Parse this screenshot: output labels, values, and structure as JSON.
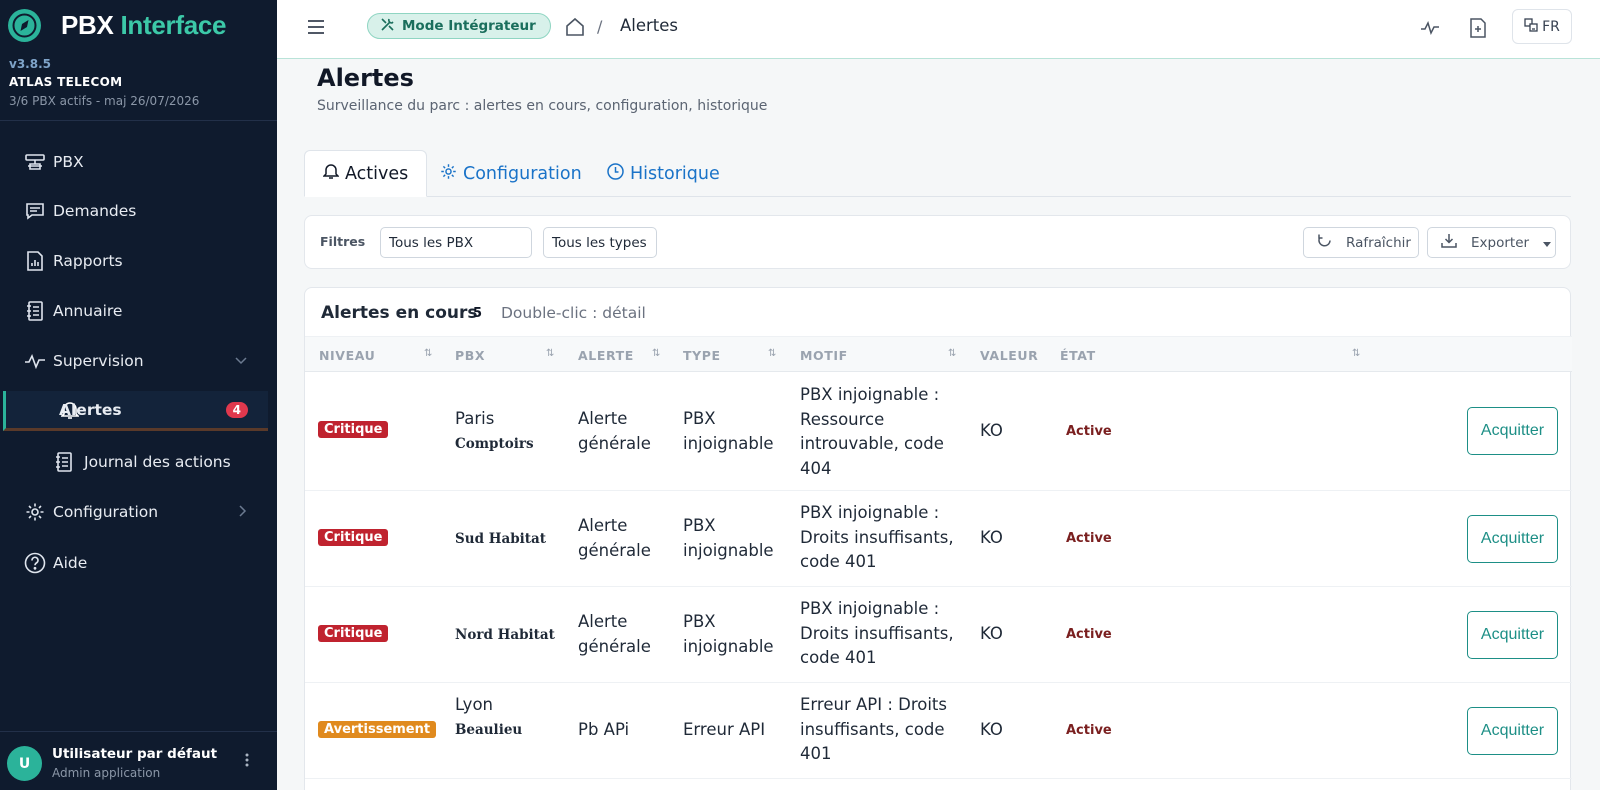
{
  "brand": {
    "name_part1": "PBX",
    "name_part2": "Interface",
    "version": "v3.8.5",
    "company": "ATLAS TELECOM",
    "subinfo": "3/6 PBX actifs - maj 26/07/2026"
  },
  "nav": {
    "pbx": "PBX",
    "demandes": "Demandes",
    "rapports": "Rapports",
    "annuaire": "Annuaire",
    "supervision": "Supervision",
    "alertes": "Alertes",
    "alertes_badge": "4",
    "journal": "Journal des actions",
    "configuration": "Configuration",
    "aide": "Aide"
  },
  "user": {
    "initial": "U",
    "name": "Utilisateur par défaut",
    "role": "Admin application"
  },
  "topbar": {
    "mode_label": "Mode Intégrateur",
    "breadcrumb_sep": "/",
    "breadcrumb_current": "Alertes",
    "lang": "FR"
  },
  "page": {
    "title": "Alertes",
    "subtitle": "Surveillance du parc : alertes en cours, configuration, historique"
  },
  "tabs": {
    "actives": "Actives",
    "configuration": "Configuration",
    "historique": "Historique"
  },
  "filters": {
    "label": "Filtres",
    "pbx_select": "Tous les PBX",
    "type_select": "Tous les types",
    "refresh": "Rafraîchir",
    "export": "Exporter"
  },
  "table": {
    "title": "Alertes en cours",
    "count": "5",
    "hint": "Double-clic : détail",
    "headers": {
      "niveau": "NIVEAU",
      "pbx": "PBX",
      "alerte": "ALERTE",
      "type": "TYPE",
      "motif": "MOTIF",
      "valeur": "VALEUR",
      "etat": "ÉTAT"
    },
    "action_label": "Acquitter",
    "rows": [
      {
        "niveau": "Critique",
        "pbx1": "Paris",
        "pbx2": "Comptoirs",
        "alerte1": "Alerte",
        "alerte2": "générale",
        "type1": "PBX",
        "type2": "injoignable",
        "motif1": "PBX injoignable :",
        "motif2": "Ressource",
        "motif3": "introuvable, code",
        "motif4": "404",
        "valeur": "KO",
        "etat": "Active"
      },
      {
        "niveau": "Critique",
        "pbx1": "Sud Habitat",
        "alerte1": "Alerte",
        "alerte2": "générale",
        "type1": "PBX",
        "type2": "injoignable",
        "motif1": "PBX injoignable :",
        "motif2": "Droits insuffisants,",
        "motif3": "code 401",
        "valeur": "KO",
        "etat": "Active"
      },
      {
        "niveau": "Critique",
        "pbx1": "Nord Habitat",
        "alerte1": "Alerte",
        "alerte2": "générale",
        "type1": "PBX",
        "type2": "injoignable",
        "motif1": "PBX injoignable :",
        "motif2": "Droits insuffisants,",
        "motif3": "code 401",
        "valeur": "KO",
        "etat": "Active"
      },
      {
        "niveau": "Avertissement",
        "pbx1": "Lyon",
        "pbx2": "Beaulieu",
        "alerte1": "Pb APi",
        "type1": "Erreur API",
        "motif1": "Erreur API : Droits",
        "motif2": "insuffisants, code",
        "motif3": "401",
        "valeur": "KO",
        "etat": "Active"
      }
    ]
  },
  "colors": {
    "accent": "#2bb39a",
    "sidebar_bg": "#0f1b2e",
    "critical": "#c0232f",
    "warning": "#e08a1e",
    "link": "#1a73c8"
  }
}
